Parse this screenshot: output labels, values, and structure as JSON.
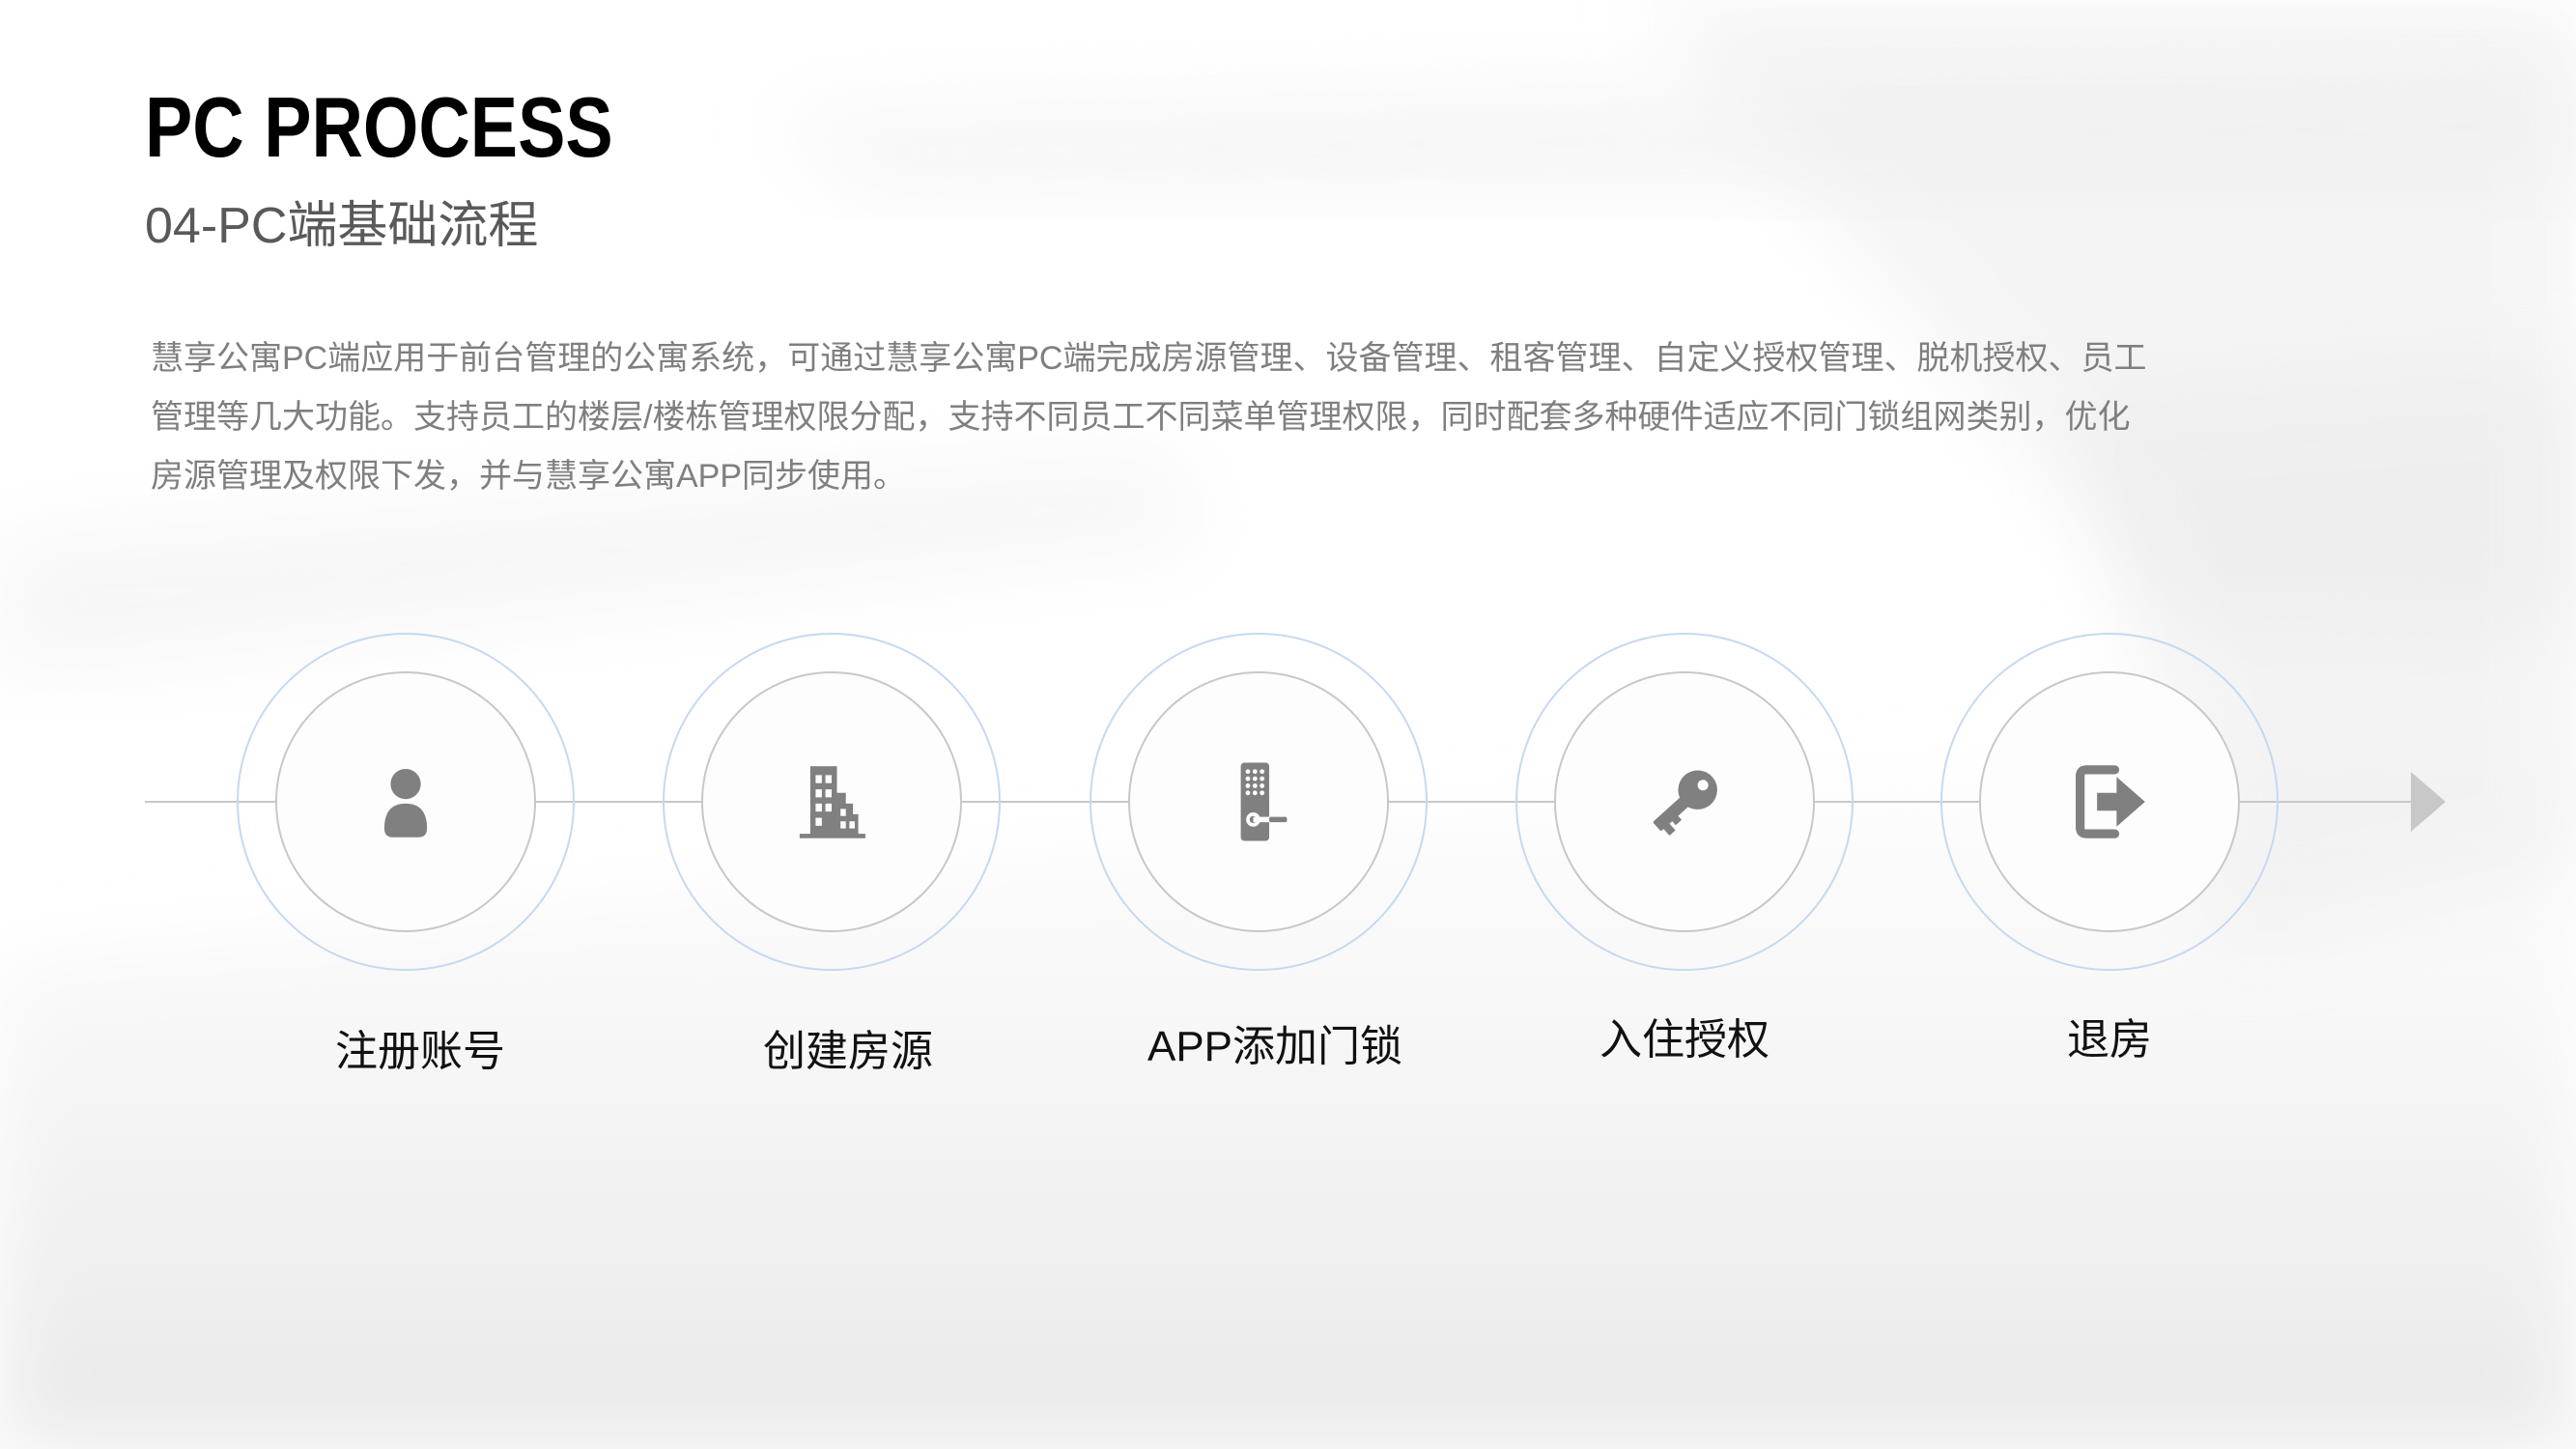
{
  "slide": {
    "title": "PC PROCESS",
    "subtitle": "04-PC端基础流程",
    "description_lines": [
      "慧享公寓PC端应用于前台管理的公寓系统，可通过慧享公寓PC端完成房源管理、设备管理、租客管理、自定义授权管理、脱机授权、员工",
      "管理等几大功能。支持员工的楼层/楼栋管理权限分配，支持不同员工不同菜单管理权限，同时配套多种硬件适应不同门锁组网类别，优化",
      "房源管理及权限下发，并与慧享公寓APP同步使用。"
    ]
  },
  "process": {
    "steps": [
      {
        "label": "注册账号",
        "icon": "user-icon"
      },
      {
        "label": "创建房源",
        "icon": "building-icon"
      },
      {
        "label": "APP添加门锁",
        "icon": "door-lock-icon"
      },
      {
        "label": "入住授权",
        "icon": "key-icon"
      },
      {
        "label": "退房",
        "icon": "logout-icon"
      }
    ]
  },
  "colors": {
    "title": "#000000",
    "subtitle": "#595959",
    "body_text": "#7f7f7f",
    "icon": "#808080",
    "outer_ring": "#c5d9f1",
    "inner_ring": "#c8c8c8",
    "connector_line": "#c8c8c8",
    "background": "#ffffff"
  }
}
